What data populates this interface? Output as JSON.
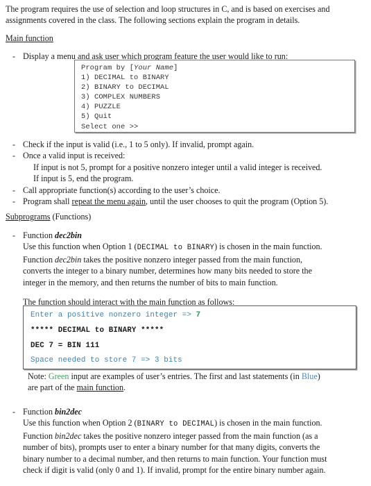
{
  "document": {
    "intro": {
      "line1": "The program requires the use of selection and loop structures in C, and is based on exercises and",
      "line2": "assignments covered in the class.  The following sections explain the program in details."
    },
    "main_function": {
      "heading": "Main function",
      "bullets": [
        {
          "dash": "-",
          "text": "Display a menu and ask user which program feature the user would like to run:"
        },
        {
          "dash": "-",
          "text": "Check if the input is valid (i.e., 1 to 5 only).  If invalid, prompt again."
        },
        {
          "dash": "-",
          "text": "Once a valid input is received:"
        },
        {
          "dash": "-",
          "text": "Call appropriate function(s) according to the user’s choice."
        }
      ],
      "sub_lines": [
        "If input is not 5, prompt for a positive nonzero integer until a valid integer is received.",
        "If input is 5, end the program."
      ],
      "last_bullet": {
        "dash": "-",
        "prefix": "Program shall ",
        "underlined": "repeat the menu again",
        "suffix": ", until the user chooses to quit the program (Option 5)."
      }
    },
    "menu_box": {
      "name": "console-menu-output",
      "lines": [
        {
          "plain": "Program by [",
          "italic": "Your Name",
          "tail": "]"
        },
        {
          "plain": "1) DECIMAL to BINARY"
        },
        {
          "plain": "2) BINARY to DECIMAL"
        },
        {
          "plain": "3) COMPLEX NUMBERS"
        },
        {
          "plain": "4) PUZZLE"
        },
        {
          "plain": "5) Quit"
        },
        {
          "plain": "Select one >>"
        }
      ]
    },
    "subprograms": {
      "heading_underlined": "Subprograms",
      "heading_rest": " (Functions)",
      "dec2bin": {
        "dash": "-",
        "title_prefix": "Function ",
        "title_name": "dec2bin",
        "line1_a": "Use this function when Option 1 (",
        "line1_mono": "DECIMAL to BINARY",
        "line1_b": ") is chosen in the main function.",
        "line2_a": "Function ",
        "line2_em": "dec2bin",
        "line2_b": " takes the positive nonzero integer passed from the main function,",
        "line3": "converts the integer to a binary number, determines how many bits needed to store the",
        "line4": "integer in the memory, and then returns the number of bits to main function.",
        "interact_lead": "The function should interact with the main function as follows:",
        "note": {
          "a": "Note: ",
          "green": "Green",
          "b": " input are examples of user’s entries.  The first and last statements (in ",
          "blue": "Blue",
          "c": ")",
          "d": "are part of the ",
          "underlined": "main function",
          "e": "."
        }
      },
      "code_box": {
        "name": "console-dec2bin-output",
        "lines": [
          {
            "segments": [
              {
                "text": "Enter a positive nonzero integer => ",
                "color": "blue"
              },
              {
                "text": "7",
                "color": "green"
              }
            ]
          },
          {
            "segments": [
              {
                "text": "***** DECIMAL to BINARY *****",
                "color": "black"
              }
            ]
          },
          {
            "segments": [
              {
                "text": "DEC 7 = BIN 111",
                "color": "black"
              }
            ]
          },
          {
            "segments": [
              {
                "text": "Space needed to store 7 => 3 bits",
                "color": "blue"
              }
            ]
          }
        ]
      },
      "bin2dec": {
        "dash": "-",
        "title_prefix": "Function ",
        "title_name": "bin2dec",
        "line1_a": "Use this function when Option 2 (",
        "line1_mono": "BINARY to DECIMAL",
        "line1_b": ") is chosen in the main function.",
        "line2_a": "Function ",
        "line2_em": "bin2dec",
        "line2_b": " takes the positive nonzero integer passed from the main function (as a",
        "line3": "number of bits), prompts user to enter a binary number for that many digits, converts the",
        "line4": "binary number to a decimal number, and then returns to main function. Your function must",
        "line5": "check if digit is valid (only 0 and 1).  If invalid, prompt for the entire binary number again."
      }
    },
    "colors": {
      "console_blue": "#3c82b4",
      "console_green": "#14a05a",
      "text_green": "#3f9c5e",
      "text_blue": "#4a86c8",
      "box_border": "#5b5b5b"
    }
  }
}
